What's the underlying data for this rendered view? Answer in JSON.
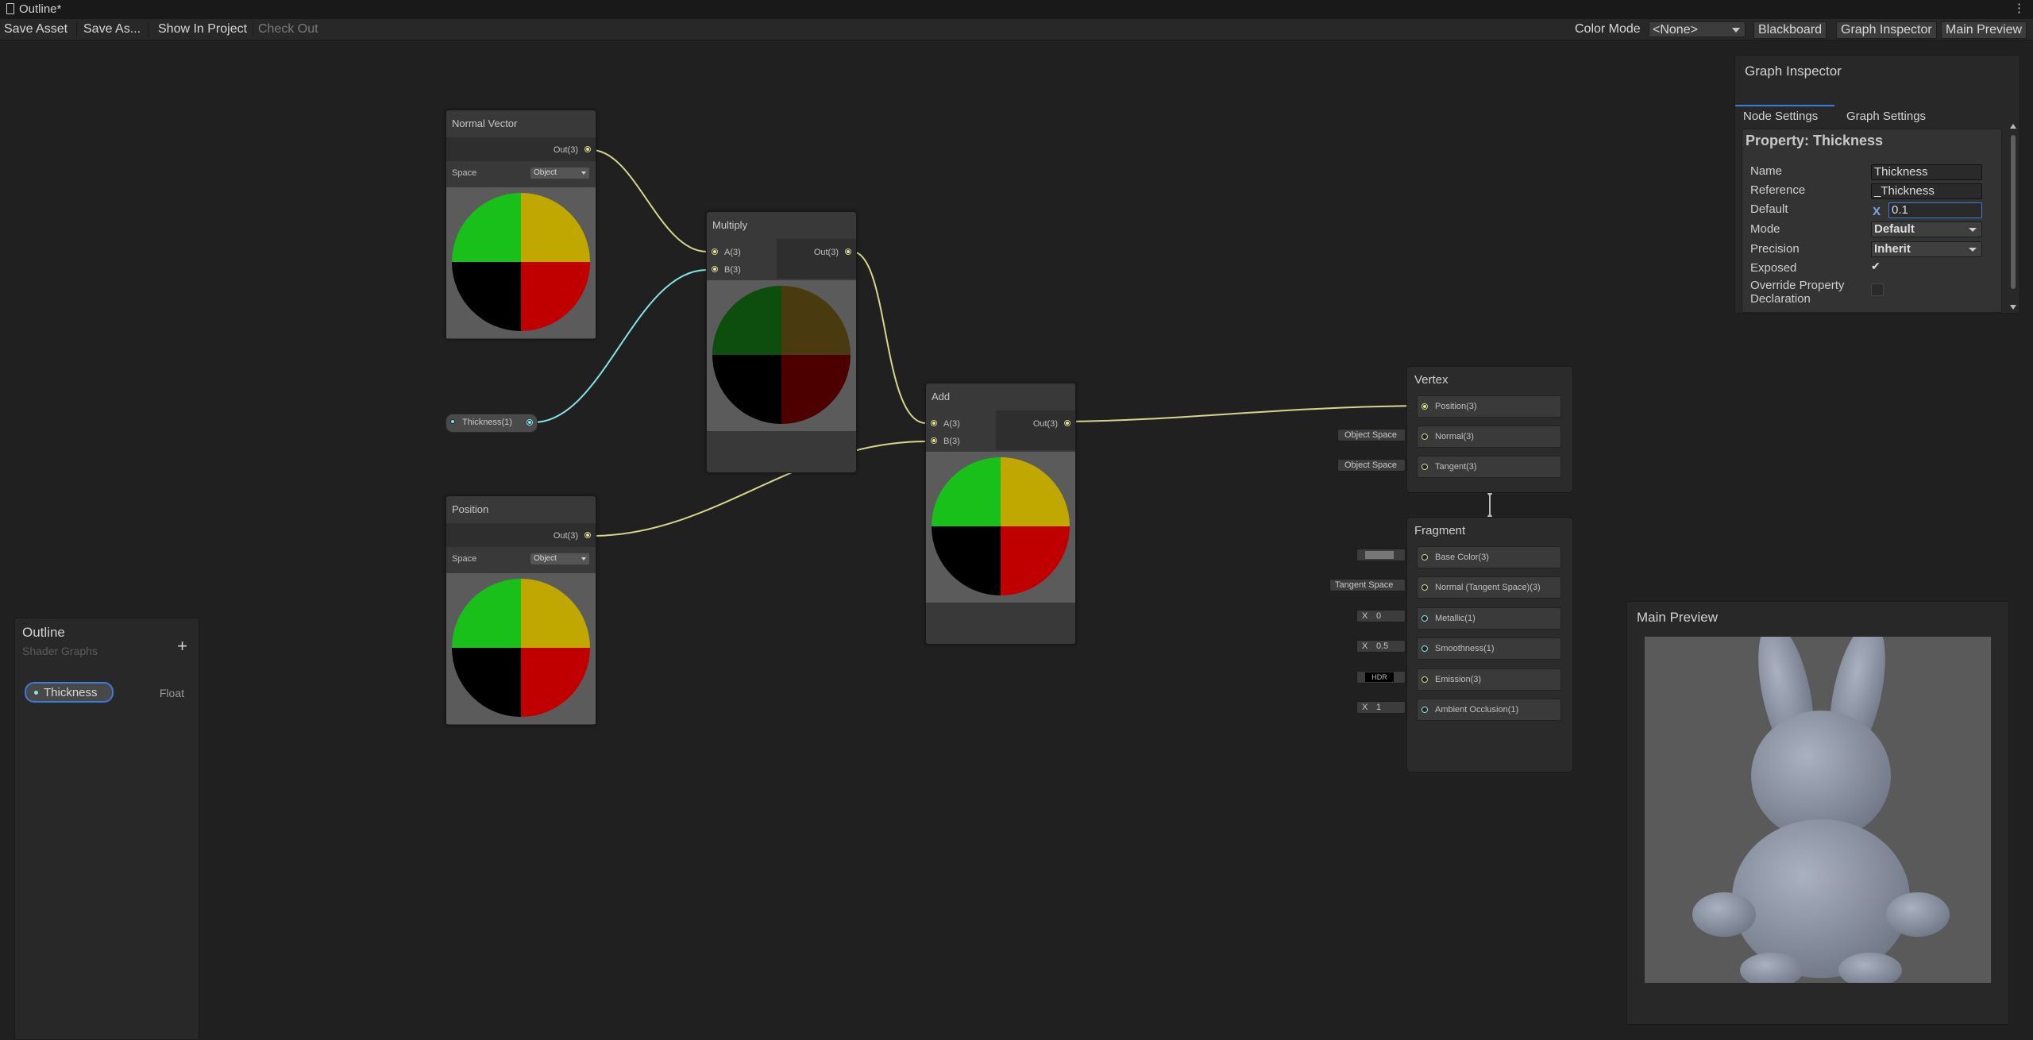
{
  "window": {
    "title": "Outline*"
  },
  "toolbar": {
    "save_asset": "Save Asset",
    "save_as": "Save As...",
    "show_in_project": "Show In Project",
    "check_out": "Check Out",
    "color_mode_label": "Color Mode",
    "color_mode_value": "<None>",
    "blackboard": "Blackboard",
    "graph_inspector": "Graph Inspector",
    "main_preview": "Main Preview"
  },
  "nodes": {
    "normal_vector": {
      "title": "Normal Vector",
      "out": "Out(3)",
      "space_label": "Space",
      "space_value": "Object"
    },
    "position": {
      "title": "Position",
      "out": "Out(3)",
      "space_label": "Space",
      "space_value": "Object"
    },
    "multiply": {
      "title": "Multiply",
      "in_a": "A(3)",
      "in_b": "B(3)",
      "out": "Out(3)"
    },
    "add": {
      "title": "Add",
      "in_a": "A(3)",
      "in_b": "B(3)",
      "out": "Out(3)"
    },
    "thickness": {
      "label": "Thickness(1)"
    }
  },
  "master": {
    "vertex": {
      "title": "Vertex",
      "slots": [
        "Position(3)",
        "Normal(3)",
        "Tangent(3)"
      ],
      "inputs": [
        "",
        "Object Space",
        "Object Space"
      ]
    },
    "fragment": {
      "title": "Fragment",
      "slots": [
        "Base Color(3)",
        "Normal (Tangent Space)(3)",
        "Metallic(1)",
        "Smoothness(1)",
        "Emission(3)",
        "Ambient Occlusion(1)"
      ],
      "inputs": {
        "normal": "Tangent Space",
        "metallic_axis": "X",
        "metallic": "0",
        "smoothness_axis": "X",
        "smoothness": "0.5",
        "emission": "HDR",
        "ao_axis": "X",
        "ao": "1"
      },
      "base_color": "#777777"
    }
  },
  "blackboard": {
    "title": "Outline",
    "subtitle": "Shader Graphs",
    "add": "+",
    "property_name": "Thickness",
    "property_type": "Float"
  },
  "inspector": {
    "title": "Graph Inspector",
    "tabs": [
      "Node Settings",
      "Graph Settings"
    ],
    "section_title": "Property: Thickness",
    "labels": [
      "Name",
      "Reference",
      "Default",
      "Mode",
      "Precision",
      "Exposed",
      "Override Property Declaration"
    ],
    "name_value": "Thickness",
    "reference_value": "_Thickness",
    "default_axis": "X",
    "default_value": "0.1",
    "mode_value": "Default",
    "precision_value": "Inherit",
    "exposed_check": "✔"
  },
  "main_preview": {
    "title": "Main Preview"
  },
  "colors": {
    "wire_vec3": "#d6d68c",
    "wire_float": "#84e4e7",
    "accent": "#3d7bd9"
  }
}
